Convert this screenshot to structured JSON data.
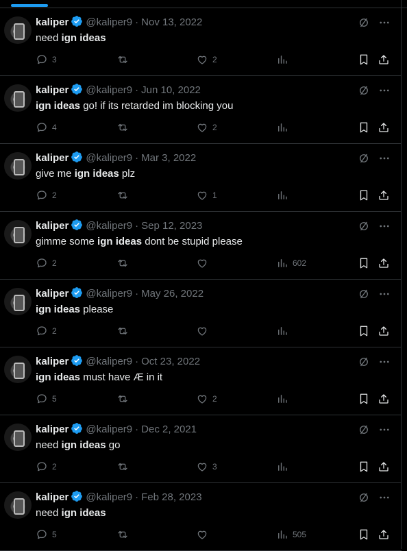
{
  "ui": {
    "accent": "#1d9bf0",
    "muted": "#71767b",
    "background": "#000000"
  },
  "tweets": [
    {
      "name": "kaliper",
      "handle": "@kaliper9",
      "sep": "·",
      "date": "Nov 13, 2022",
      "parts": [
        {
          "t": "need ",
          "b": false
        },
        {
          "t": "ign ideas",
          "b": true
        }
      ],
      "replies": "3",
      "likes": "2",
      "views": ""
    },
    {
      "name": "kaliper",
      "handle": "@kaliper9",
      "sep": "·",
      "date": "Jun 10, 2022",
      "parts": [
        {
          "t": "ign ideas",
          "b": true
        },
        {
          "t": " go! if its retarded im blocking you",
          "b": false
        }
      ],
      "replies": "4",
      "likes": "2",
      "views": ""
    },
    {
      "name": "kaliper",
      "handle": "@kaliper9",
      "sep": "·",
      "date": "Mar 3, 2022",
      "parts": [
        {
          "t": "give me ",
          "b": false
        },
        {
          "t": "ign ideas",
          "b": true
        },
        {
          "t": " plz",
          "b": false
        }
      ],
      "replies": "2",
      "likes": "1",
      "views": ""
    },
    {
      "name": "kaliper",
      "handle": "@kaliper9",
      "sep": "·",
      "date": "Sep 12, 2023",
      "parts": [
        {
          "t": "gimme some ",
          "b": false
        },
        {
          "t": "ign ideas",
          "b": true
        },
        {
          "t": " dont be stupid please",
          "b": false
        }
      ],
      "replies": "2",
      "likes": "",
      "views": "602"
    },
    {
      "name": "kaliper",
      "handle": "@kaliper9",
      "sep": "·",
      "date": "May 26, 2022",
      "parts": [
        {
          "t": "ign ideas",
          "b": true
        },
        {
          "t": " please",
          "b": false
        }
      ],
      "replies": "2",
      "likes": "",
      "views": ""
    },
    {
      "name": "kaliper",
      "handle": "@kaliper9",
      "sep": "·",
      "date": "Oct 23, 2022",
      "parts": [
        {
          "t": "ign ideas",
          "b": true
        },
        {
          "t": " must have Æ in it",
          "b": false
        }
      ],
      "replies": "5",
      "likes": "2",
      "views": ""
    },
    {
      "name": "kaliper",
      "handle": "@kaliper9",
      "sep": "·",
      "date": "Dec 2, 2021",
      "parts": [
        {
          "t": "need ",
          "b": false
        },
        {
          "t": "ign ideas",
          "b": true
        },
        {
          "t": " go",
          "b": false
        }
      ],
      "replies": "2",
      "likes": "3",
      "views": ""
    },
    {
      "name": "kaliper",
      "handle": "@kaliper9",
      "sep": "·",
      "date": "Feb 28, 2023",
      "parts": [
        {
          "t": "need ",
          "b": false
        },
        {
          "t": "ign ideas",
          "b": true
        }
      ],
      "replies": "5",
      "likes": "",
      "views": "505"
    }
  ]
}
